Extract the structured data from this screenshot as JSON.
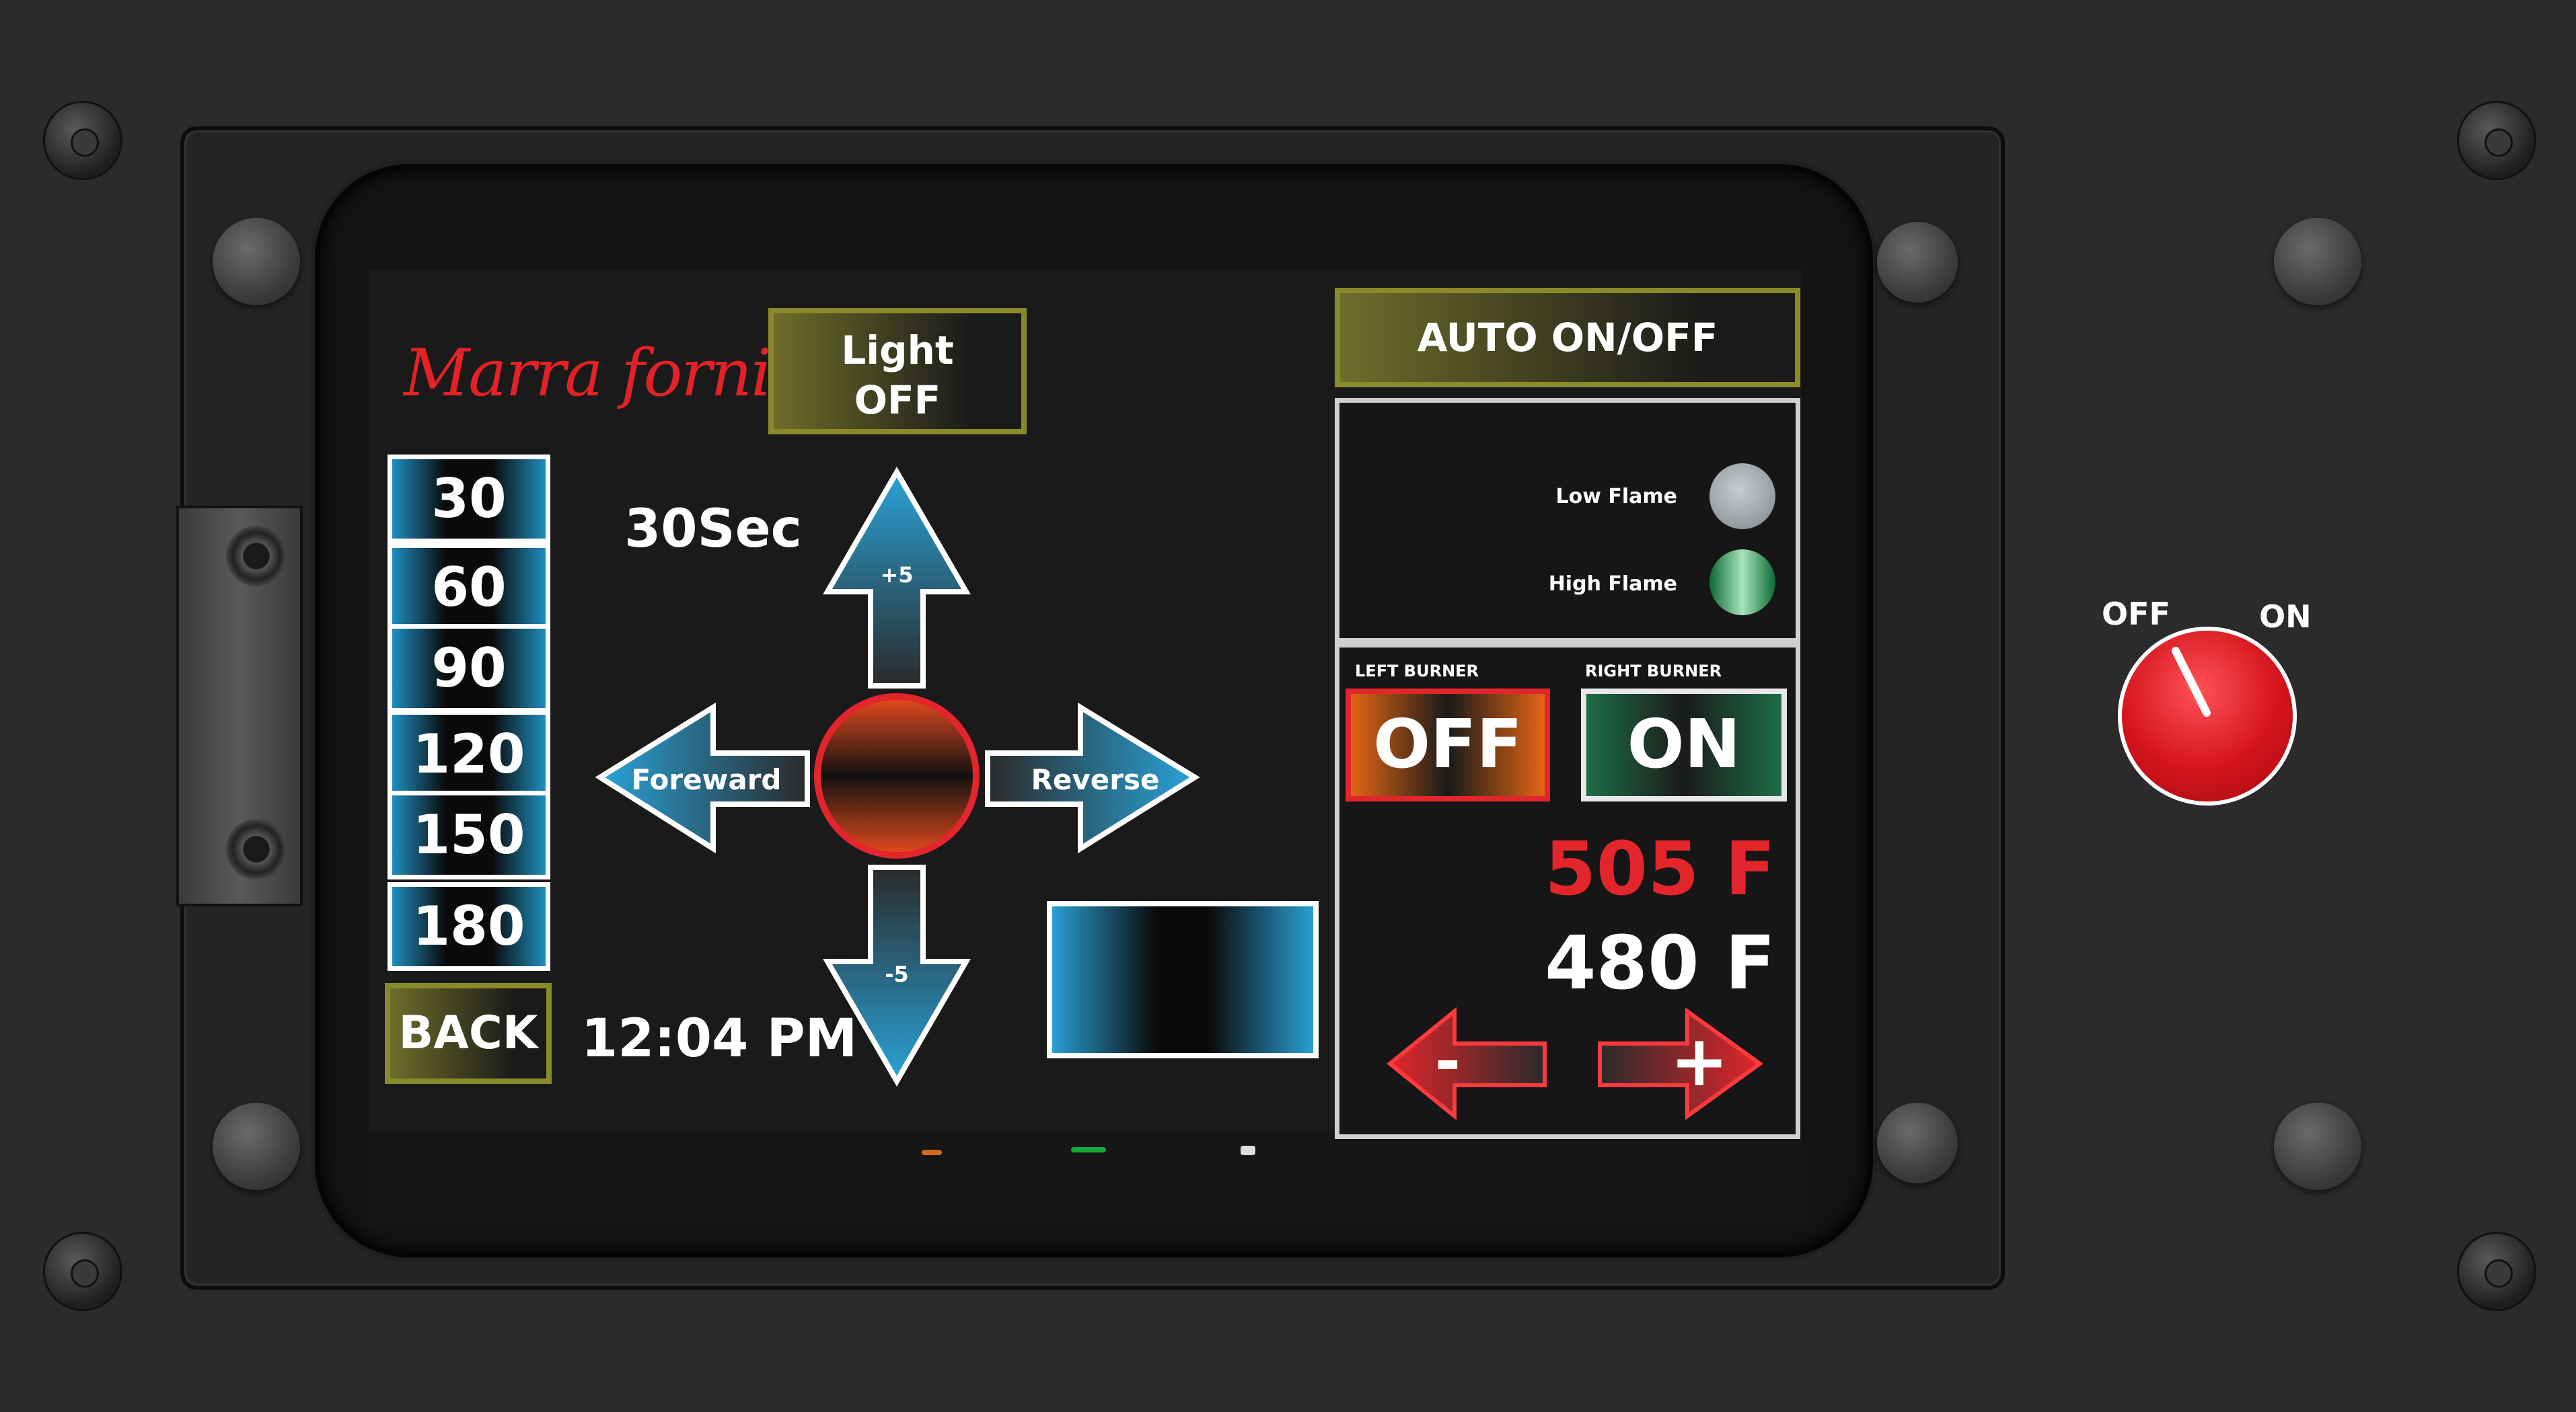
{
  "brand": {
    "name": "Marra forni"
  },
  "light_button": {
    "line1": "Light",
    "line2": "OFF"
  },
  "timer": {
    "options": [
      "30",
      "60",
      "90",
      "120",
      "150",
      "180"
    ],
    "back_label": "BACK",
    "selected_label": "30Sec"
  },
  "clock": "12:04 PM",
  "direction": {
    "forward_label": "Foreward",
    "reverse_label": "Reverse",
    "up_label": "+5",
    "down_label": "-5"
  },
  "auto_button": {
    "label": "AUTO  ON/OFF"
  },
  "flame": {
    "low_label": "Low Flame",
    "high_label": "High Flame",
    "low_color": "#9aa3a6",
    "high_color": "#1f8a4c"
  },
  "burners": {
    "left_label": "LEFT BURNER",
    "right_label": "RIGHT BURNER",
    "left_state": "OFF",
    "right_state": "ON"
  },
  "temperature": {
    "actual": "505 F",
    "setpoint": "480 F",
    "actual_color": "#e3262b",
    "setpoint_color": "#ffffff"
  },
  "adjust": {
    "minus_label": "-",
    "plus_label": "+"
  },
  "power_switch": {
    "off_label": "OFF",
    "on_label": "ON",
    "accent_color": "#d4141c"
  }
}
